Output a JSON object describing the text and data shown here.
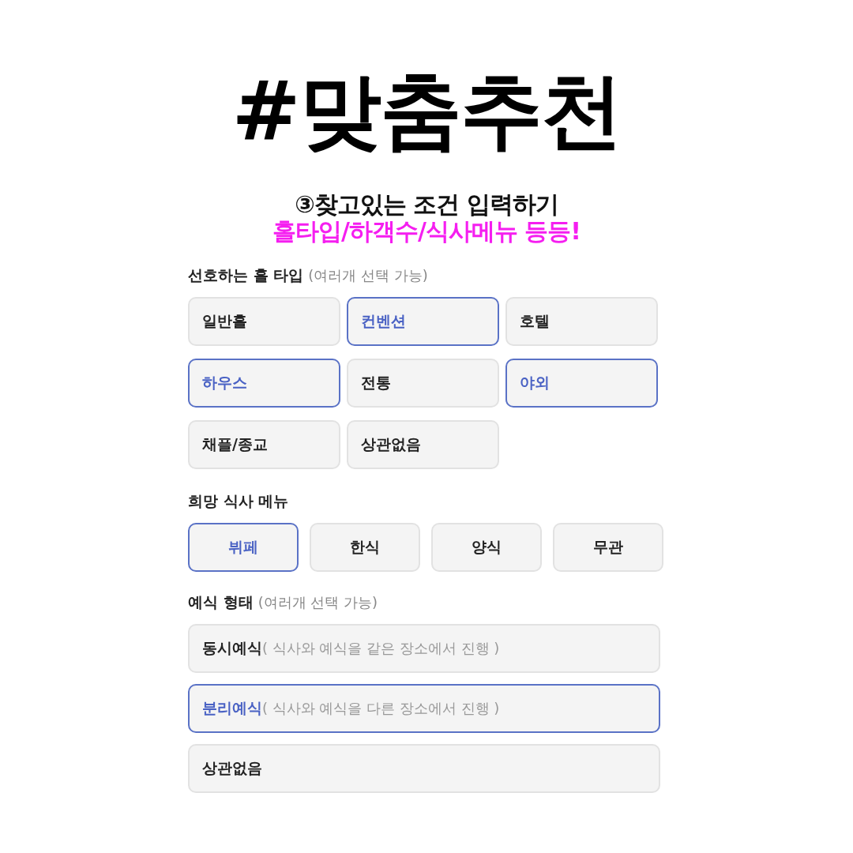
{
  "headline": "#맞춤추천",
  "step": "③찾고있는 조건 입력하기",
  "highlight": "홀타입/하객수/식사메뉴 등등!",
  "sections": [
    {
      "kind": "grid3",
      "label": "선호하는 홀 타입",
      "hint": "(여러개 선택 가능)",
      "options": [
        {
          "label": "일반홀",
          "selected": false
        },
        {
          "label": "컨벤션",
          "selected": true
        },
        {
          "label": "호텔",
          "selected": false
        },
        {
          "label": "하우스",
          "selected": true
        },
        {
          "label": "전통",
          "selected": false
        },
        {
          "label": "야외",
          "selected": true
        },
        {
          "label": "채플/종교",
          "selected": false
        },
        {
          "label": "상관없음",
          "selected": false
        }
      ]
    },
    {
      "kind": "grid4",
      "label": "희망 식사 메뉴",
      "options": [
        {
          "label": "뷔페",
          "selected": true
        },
        {
          "label": "한식",
          "selected": false
        },
        {
          "label": "양식",
          "selected": false
        },
        {
          "label": "무관",
          "selected": false
        }
      ]
    },
    {
      "kind": "list",
      "label": "예식 형태",
      "hint": "(여러개 선택 가능)",
      "options": [
        {
          "label": "동시예식",
          "note": "( 식사와 예식을 같은 장소에서 진행 )",
          "selected": false
        },
        {
          "label": "분리예식",
          "note": "( 식사와 예식을 다른 장소에서 진행 )",
          "selected": true
        },
        {
          "label": "상관없음",
          "selected": false
        }
      ]
    }
  ]
}
